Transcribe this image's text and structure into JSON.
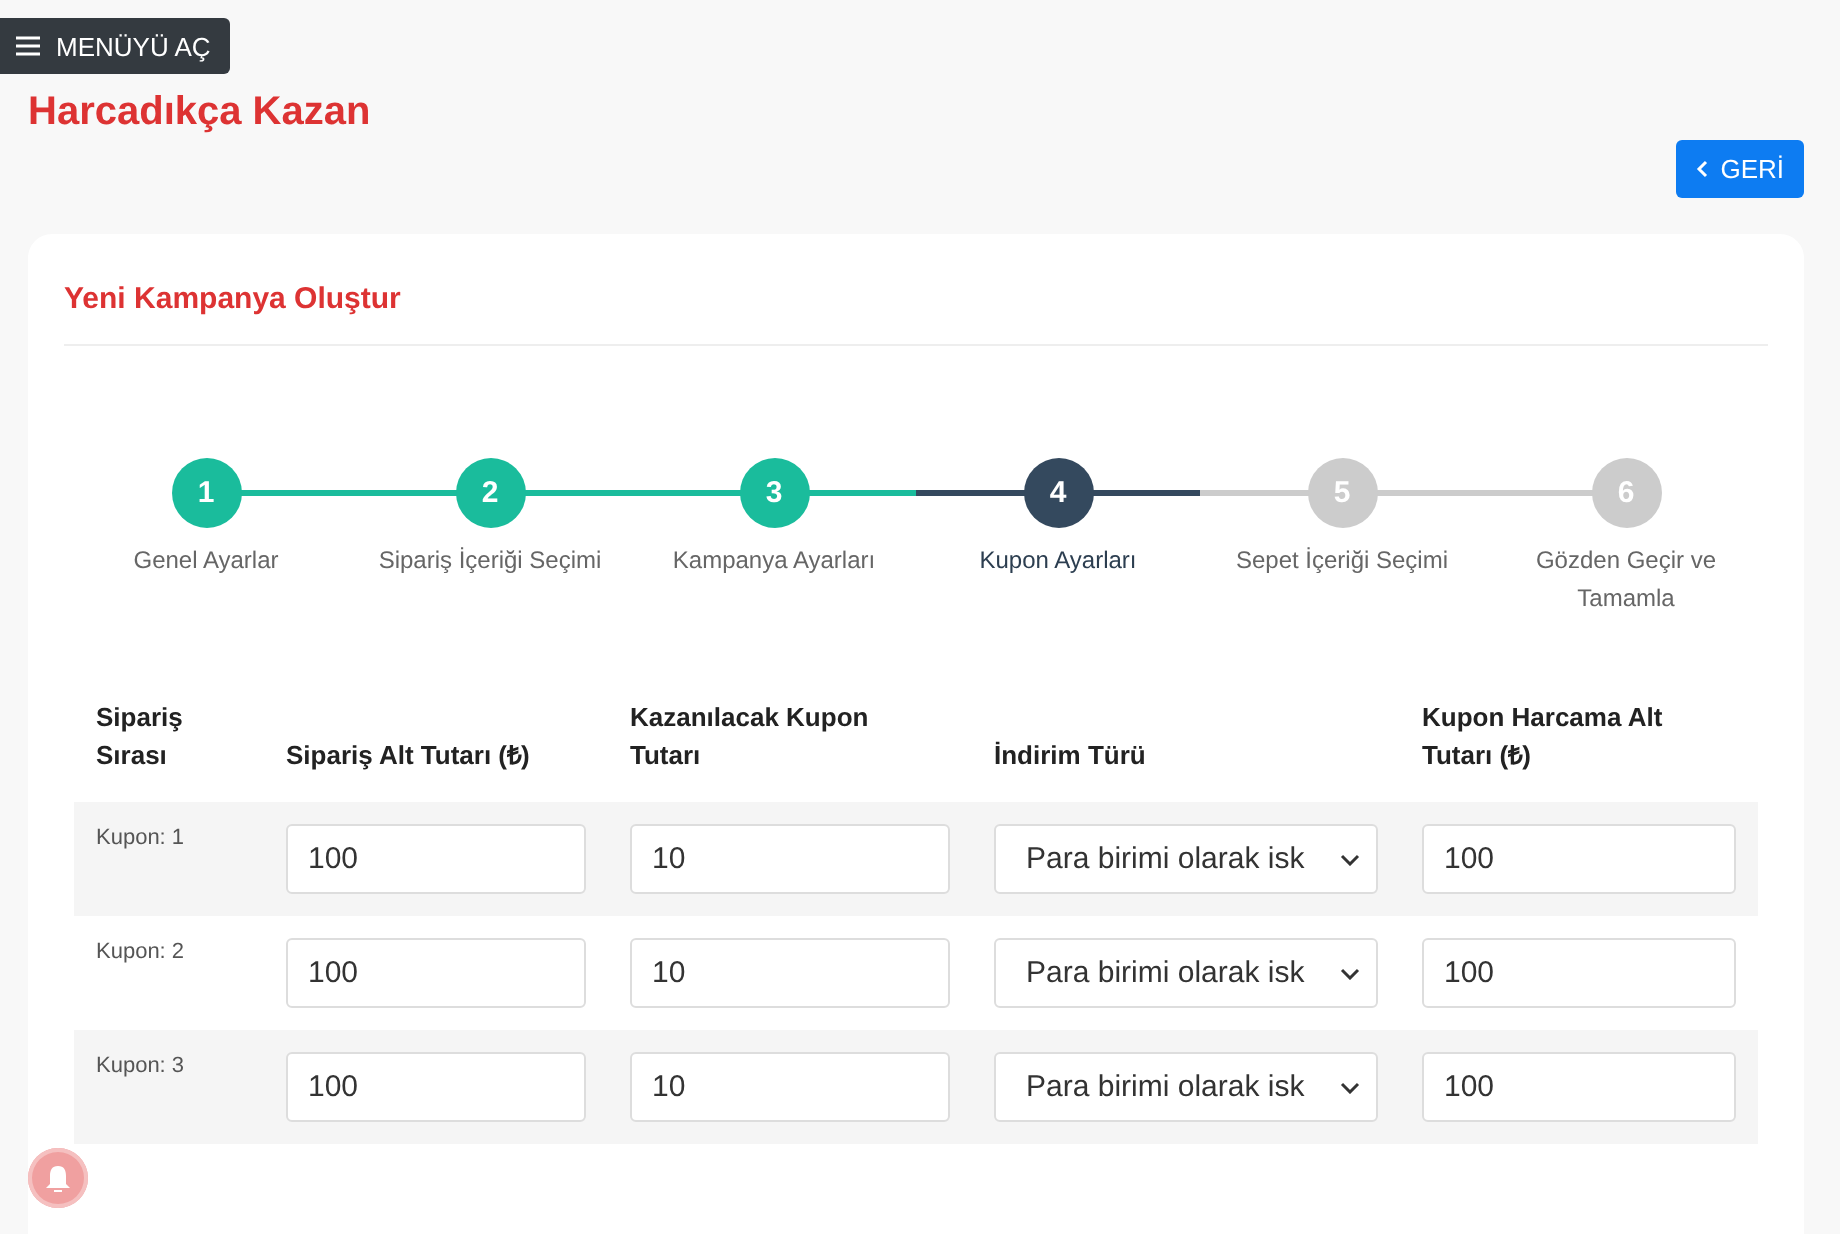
{
  "menu_button": {
    "label": "MENÜYÜ AÇ"
  },
  "page_title": "Harcadıkça Kazan",
  "back_button": {
    "label": "GERİ"
  },
  "card": {
    "title": "Yeni Kampanya Oluştur",
    "steps": [
      {
        "number": "1",
        "label": "Genel Ayarlar",
        "completed": true,
        "selected": false
      },
      {
        "number": "2",
        "label": "Sipariş İçeriği Seçimi",
        "completed": true,
        "selected": false
      },
      {
        "number": "3",
        "label": "Kampanya Ayarları",
        "completed": true,
        "selected": false
      },
      {
        "number": "4",
        "label": "Kupon Ayarları",
        "completed": false,
        "selected": true
      },
      {
        "number": "5",
        "label": "Sepet İçeriği Seçimi",
        "completed": false,
        "selected": false
      },
      {
        "number": "6",
        "label": "Gözden Geçir ve Tamamla",
        "completed": false,
        "selected": false
      }
    ],
    "table": {
      "columns": [
        "Sipariş Sırası",
        "Sipariş Alt Tutarı (₺)",
        "Kazanılacak Kupon Tutarı",
        "İndirim Türü",
        "Kupon Harcama Alt Tutarı (₺)"
      ],
      "rows": [
        {
          "label": "Kupon: 1",
          "min_order": "100",
          "coupon_amount": "10",
          "discount_type": "Para birimi olarak isk",
          "min_spend": "100"
        },
        {
          "label": "Kupon: 2",
          "min_order": "100",
          "coupon_amount": "10",
          "discount_type": "Para birimi olarak isk",
          "min_spend": "100"
        },
        {
          "label": "Kupon: 3",
          "min_order": "100",
          "coupon_amount": "10",
          "discount_type": "Para birimi olarak isk",
          "min_spend": "100"
        }
      ]
    }
  }
}
